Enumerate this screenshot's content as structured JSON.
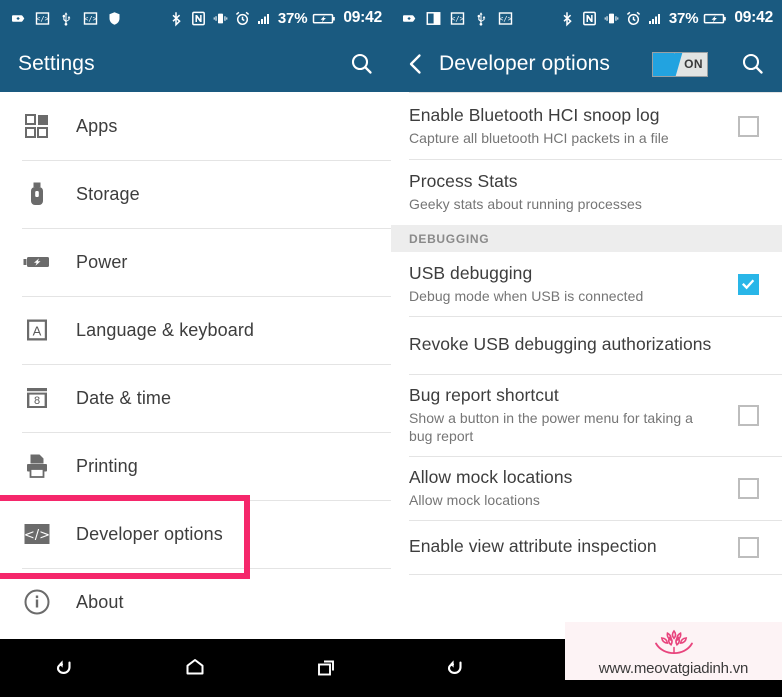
{
  "colors": {
    "header_blue": "#1a5a80",
    "highlight_pink": "#f5276b",
    "checkbox_cyan": "#29b6e8",
    "toggle_cyan": "#22a3e0",
    "navbar_black": "#000000"
  },
  "left_panel": {
    "statusbar": {
      "icons": [
        "sd-card-icon",
        "screenshot-icon",
        "usb-debug-icon",
        "code-icon",
        "shield-icon",
        "bluetooth-icon",
        "nfc-icon",
        "vibrate-icon",
        "alarm-icon",
        "signal-icon"
      ],
      "battery_percent": "37%",
      "battery_icon": "battery-charging-icon",
      "clock": "09:42"
    },
    "appbar": {
      "title": "Settings",
      "search_icon": "search-icon"
    },
    "items": [
      {
        "label": "Apps",
        "icon": "apps-grid-icon"
      },
      {
        "label": "Storage",
        "icon": "usb-drive-icon"
      },
      {
        "label": "Power",
        "icon": "battery-icon"
      },
      {
        "label": "Language & keyboard",
        "icon": "language-a-icon"
      },
      {
        "label": "Date & time",
        "icon": "calendar-8-icon"
      },
      {
        "label": "Printing",
        "icon": "printer-icon"
      },
      {
        "label": "Developer options",
        "icon": "code-brackets-icon"
      },
      {
        "label": "About",
        "icon": "info-circle-icon"
      }
    ],
    "navbar": {
      "back": "back-icon",
      "home": "home-icon",
      "recents": "recents-icon"
    }
  },
  "right_panel": {
    "statusbar": {
      "icons": [
        "sd-card-icon",
        "screenshot-icon",
        "screenshot-frame-icon",
        "usb-debug-icon",
        "code-icon",
        "bluetooth-icon",
        "nfc-icon",
        "vibrate-icon",
        "alarm-icon",
        "signal-icon"
      ],
      "battery_percent": "37%",
      "battery_icon": "battery-charging-icon",
      "clock": "09:42"
    },
    "appbar": {
      "back_icon": "chevron-left-icon",
      "title": "Developer options",
      "toggle_label": "ON",
      "toggle_state": "on",
      "search_icon": "search-icon"
    },
    "rows": [
      {
        "title": "Enable Bluetooth HCI snoop log",
        "subtitle": "Capture all bluetooth HCI packets in a file",
        "checkbox": "unchecked"
      },
      {
        "title": "Process Stats",
        "subtitle": "Geeky stats about running processes",
        "checkbox": "none"
      }
    ],
    "section_header": "DEBUGGING",
    "debug_rows": [
      {
        "title": "USB debugging",
        "subtitle": "Debug mode when USB is connected",
        "checkbox": "checked"
      },
      {
        "title": "Revoke USB debugging authorizations",
        "subtitle": "",
        "checkbox": "none"
      },
      {
        "title": "Bug report shortcut",
        "subtitle": "Show a button in the power menu for taking a bug report",
        "checkbox": "unchecked"
      },
      {
        "title": "Allow mock locations",
        "subtitle": "Allow mock locations",
        "checkbox": "unchecked"
      },
      {
        "title": "Enable view attribute inspection",
        "subtitle": "",
        "checkbox": "unchecked"
      }
    ],
    "navbar": {
      "back": "back-icon"
    }
  },
  "watermark": {
    "text": "www.meovatgiadinh.vn",
    "logo": "lotus-flower-logo"
  }
}
